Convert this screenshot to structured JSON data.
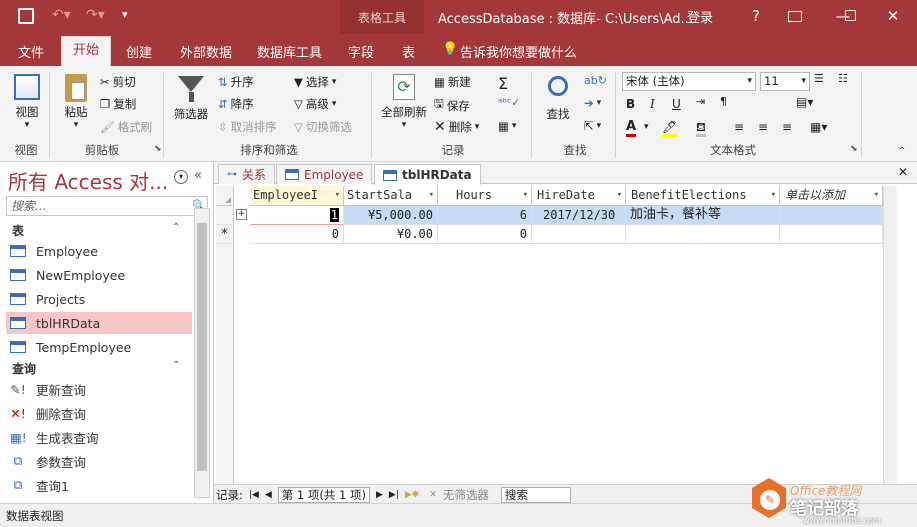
{
  "titlebar": {
    "context_tab": "表格工具",
    "window_title": "AccessDatabase : 数据库- C:\\Users\\Ad...",
    "login": "登录",
    "help": "?",
    "minimize": "—",
    "restore": "☐",
    "close": "✕"
  },
  "menu": {
    "items": [
      "文件",
      "开始",
      "创建",
      "外部数据",
      "数据库工具",
      "字段",
      "表"
    ],
    "active": "开始",
    "tell_me": "告诉我你想要做什么"
  },
  "ribbon": {
    "view": {
      "button": "视图",
      "label": "视图"
    },
    "clipboard": {
      "paste": "粘贴",
      "cut": "剪切",
      "copy": "复制",
      "format_painter": "格式刷",
      "label": "剪贴板"
    },
    "sort_filter": {
      "filter": "筛选器",
      "ascending": "升序",
      "descending": "降序",
      "remove_sort": "取消排序",
      "selection": "选择",
      "advanced": "高级",
      "toggle_filter": "切换筛选",
      "label": "排序和筛选"
    },
    "records": {
      "refresh_all": "全部刷新",
      "new": "新建",
      "save": "保存",
      "delete": "删除",
      "label": "记录"
    },
    "find": {
      "find": "查找",
      "label": "查找"
    },
    "text_format": {
      "font": "宋体 (主体)",
      "size": "11",
      "bold": "B",
      "italic": "I",
      "underline": "U",
      "label": "文本格式",
      "font_color": "#c00000",
      "highlight_color": "#ffff00"
    }
  },
  "nav": {
    "title": "所有 Access 对...",
    "search_placeholder": "搜索...",
    "tables_header": "表",
    "tables": [
      "Employee",
      "NewEmployee",
      "Projects",
      "tblHRData",
      "TempEmployee"
    ],
    "selected": "tblHRData",
    "queries_header": "查询",
    "queries": [
      "更新查询",
      "删除查询",
      "生成表查询",
      "参数查询",
      "查询1"
    ]
  },
  "doc_tabs": [
    {
      "label": "关系",
      "icon": "relationships-icon"
    },
    {
      "label": "Employee",
      "icon": "table-icon"
    },
    {
      "label": "tblHRData",
      "icon": "table-icon",
      "active": true
    }
  ],
  "grid": {
    "columns": [
      "EmployeeI",
      "StartSala",
      "Hours",
      "HireDate",
      "BenefitElections",
      "单击以添加"
    ],
    "rows": [
      [
        "1",
        "¥5,000.00",
        "6",
        "2017/12/30",
        "加油卡，餐补等",
        ""
      ],
      [
        "0",
        "¥0.00",
        "0",
        "",
        "",
        ""
      ]
    ],
    "new_row_marker": "*",
    "expand_marker": "+"
  },
  "record_nav": {
    "label": "记录:",
    "position": "第 1 项(共 1 项)",
    "filter": "无筛选器",
    "search": "搜索"
  },
  "status": {
    "text": "数据表视图"
  },
  "watermark": {
    "line1": "Office教程网",
    "line2": "笔记部落",
    "url": "www.notetribe.com"
  },
  "colors": {
    "accent": "#a4373a",
    "selection": "#c6dcf5",
    "nav_selected": "#f7c6c8"
  }
}
